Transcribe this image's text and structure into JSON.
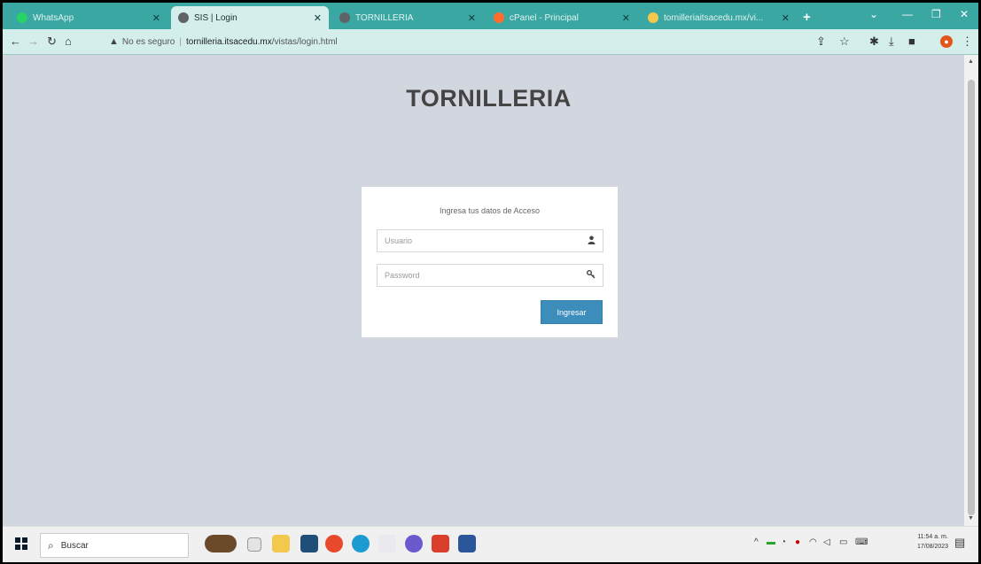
{
  "browser": {
    "tabs": [
      {
        "title": "WhatsApp",
        "color": "#25d366"
      },
      {
        "title": "SIS | Login",
        "color": "#5f6368"
      },
      {
        "title": "TORNILLERIA",
        "color": "#5f6368"
      },
      {
        "title": "cPanel - Principal",
        "color": "#ff6c2c"
      },
      {
        "title": "tornilleriaitsacedu.mx/vi...",
        "color": "#f2c94c"
      }
    ],
    "address": {
      "security_label": "No es seguro",
      "host": "tornilleria.itsacedu.mx",
      "path": "/vistas/login.html"
    }
  },
  "page": {
    "logo": "TORNILLERIA",
    "login": {
      "message": "Ingresa tus datos de Acceso",
      "username_placeholder": "Usuario",
      "password_placeholder": "Password",
      "submit_label": "Ingresar"
    }
  },
  "taskbar": {
    "search_placeholder": "Buscar",
    "clock_time": "11:54 a. m.",
    "clock_date": "17/08/2023"
  },
  "icons": {
    "user": "user-icon",
    "key": "key-icon",
    "search": "search-icon"
  },
  "colors": {
    "tabstrip": "#3ba7a3",
    "page_bg": "#d2d6de",
    "button": "#3c8dbc"
  }
}
